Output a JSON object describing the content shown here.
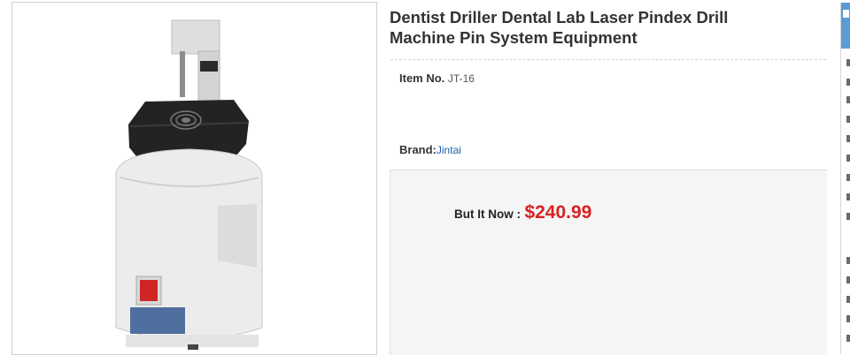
{
  "product": {
    "title": "Dentist Driller Dental Lab Laser Pindex Drill Machine Pin System Equipment",
    "item_no_label": "Item No.",
    "item_no_value": "JT-16",
    "brand_label": "Brand:",
    "brand_value": "Jintai",
    "buy_label": "But It Now :",
    "price": "$240.99"
  },
  "colors": {
    "price": "#d62222",
    "link": "#1a5fa8",
    "side_header": "#5b9bd6"
  },
  "icons": [
    "side-panel-icon"
  ]
}
